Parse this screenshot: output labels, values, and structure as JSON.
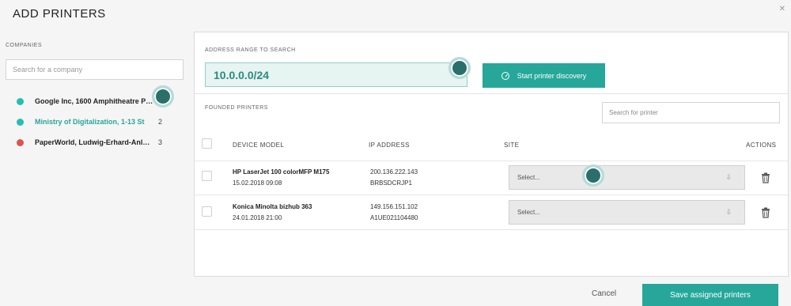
{
  "dialog": {
    "title": "ADD PRINTERS",
    "close_icon": "close-x-icon"
  },
  "sidebar": {
    "label": "COMPANIES",
    "search_placeholder": "Search for a company",
    "companies": [
      {
        "name": "Google Inc, 1600 Amphitheatre Parkway",
        "count": "",
        "color": "#26bfb0",
        "active": false
      },
      {
        "name": "Ministry of Digitalization, 1-13 St",
        "count": "2",
        "color": "#26bfb0",
        "active": true
      },
      {
        "name": "PaperWorld, Ludwig-Erhard-Anlage",
        "count": "3",
        "color": "#e2514c",
        "active": false
      }
    ]
  },
  "range": {
    "label": "ADDRESS RANGE TO SEARCH",
    "value": "10.0.0.0/24",
    "discover_label": "Start printer discovery"
  },
  "found": {
    "label": "FOUNDED PRINTERS",
    "search_placeholder": "Search for printer"
  },
  "table": {
    "headers": {
      "model": "DEVICE MODEL",
      "ip": "IP ADDRESS",
      "site": "SITE",
      "actions": "ACTIONS"
    },
    "rows": [
      {
        "model": "HP LaserJet 100 colorMFP M175",
        "date": "15.02.2018 09:08",
        "ip": "200.136.222.143",
        "host": "BRBSDCRJP1",
        "site": "Select..."
      },
      {
        "model": "Konica Minolta bizhub 363",
        "date": "24.01.2018 21:00",
        "ip": "149.156.151.102",
        "host": "A1UE021104480",
        "site": "Select..."
      }
    ]
  },
  "footer": {
    "cancel_label": "Cancel",
    "save_label": "Save assigned printers"
  },
  "colors": {
    "accent": "#26a79a",
    "marker": "#2b6f6b",
    "red": "#e2514c"
  }
}
